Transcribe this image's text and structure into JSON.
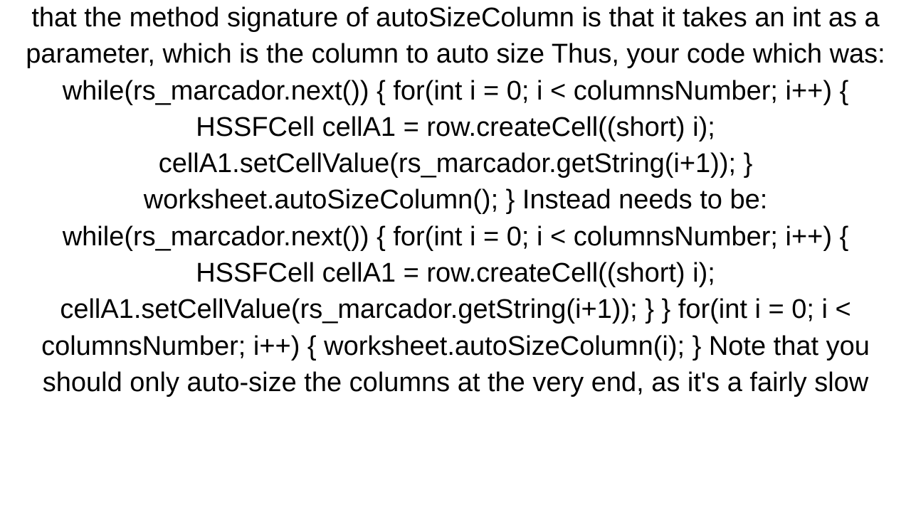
{
  "body_text": "that the method signature of autoSizeColumn is that it takes an int as a parameter, which is the column to auto size Thus, your code which was: while(rs_marcador.next()) {         for(int i = 0; i < columnsNumber; i++)         {             HSSFCell cellA1 = row.createCell((short) i);             cellA1.setCellValue(rs_marcador.getString(i+1));          }         worksheet.autoSizeColumn(); }  Instead needs to be: while(rs_marcador.next()) {         for(int i = 0; i < columnsNumber; i++)         {             HSSFCell cellA1 = row.createCell((short) i);             cellA1.setCellValue(rs_marcador.getString(i+1));          } }  for(int i = 0; i < columnsNumber; i++) {     worksheet.autoSizeColumn(i); }  Note that you should only auto-size the columns at the very end, as it's a fairly slow"
}
